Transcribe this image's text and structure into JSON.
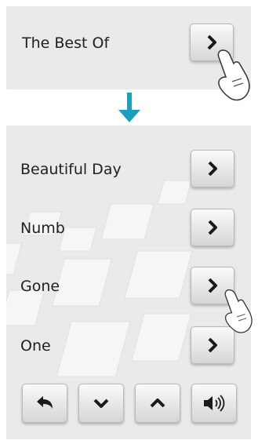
{
  "step1": {
    "playlist_label": "The Best Of",
    "open_button_icon": "chevron-right-icon"
  },
  "step2": {
    "tracks": [
      {
        "label": "Beautiful Day",
        "button_icon": "chevron-right-icon"
      },
      {
        "label": "Numb",
        "button_icon": "chevron-right-icon"
      },
      {
        "label": "Gone",
        "button_icon": "chevron-right-icon"
      },
      {
        "label": "One",
        "button_icon": "chevron-right-icon"
      }
    ],
    "controls": [
      {
        "icon": "back-arrow-icon"
      },
      {
        "icon": "chevron-down-icon"
      },
      {
        "icon": "chevron-up-icon"
      },
      {
        "icon": "speaker-icon"
      }
    ]
  },
  "colors": {
    "arrow": "#1a9fbf",
    "panel_bg": "#e9eaec"
  }
}
